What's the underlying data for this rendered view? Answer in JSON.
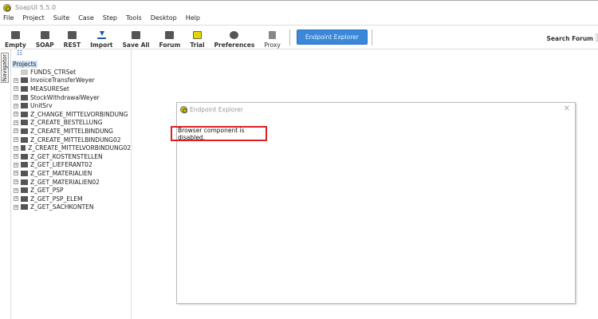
{
  "window": {
    "title": "SoapUI 5.5.0"
  },
  "menu": [
    "File",
    "Project",
    "Suite",
    "Case",
    "Step",
    "Tools",
    "Desktop",
    "Help"
  ],
  "toolbar": {
    "buttons": [
      {
        "label": "Empty",
        "icon": "empty-project-icon"
      },
      {
        "label": "SOAP",
        "icon": "soap-icon"
      },
      {
        "label": "REST",
        "icon": "rest-icon"
      },
      {
        "label": "Import",
        "icon": "import-icon"
      },
      {
        "label": "Save All",
        "icon": "save-all-icon"
      },
      {
        "label": "Forum",
        "icon": "forum-icon"
      },
      {
        "label": "Trial",
        "icon": "trial-icon"
      },
      {
        "label": "Preferences",
        "icon": "gear-icon"
      },
      {
        "label": "Proxy",
        "icon": "proxy-icon"
      }
    ],
    "endpoint_explorer": "Endpoint Explorer",
    "search_label": "Search Forum"
  },
  "navigator": {
    "tab": "Navigator",
    "root": "Projects",
    "items": [
      {
        "label": "FUNDS_CTRSet",
        "expandable": false
      },
      {
        "label": "InvoiceTransferWeyer",
        "expandable": true
      },
      {
        "label": "MEASURESet",
        "expandable": true
      },
      {
        "label": "StockWithdrawalWeyer",
        "expandable": true
      },
      {
        "label": "UnitSrv",
        "expandable": true
      },
      {
        "label": "Z_CHANGE_MITTELVORBINDUNG",
        "expandable": true
      },
      {
        "label": "Z_CREATE_BESTELLUNG",
        "expandable": true
      },
      {
        "label": "Z_CREATE_MITTELBINDUNG",
        "expandable": true
      },
      {
        "label": "Z_CREATE_MITTELBINDUNG02",
        "expandable": true
      },
      {
        "label": "Z_CREATE_MITTELVORBINDUNG02",
        "expandable": true
      },
      {
        "label": "Z_GET_KOSTENSTELLEN",
        "expandable": true
      },
      {
        "label": "Z_GET_LIEFERANT02",
        "expandable": true
      },
      {
        "label": "Z_GET_MATERIALIEN",
        "expandable": true
      },
      {
        "label": "Z_GET_MATERIALIEN02",
        "expandable": true
      },
      {
        "label": "Z_GET_PSP",
        "expandable": true
      },
      {
        "label": "Z_GET_PSP_ELEM",
        "expandable": true
      },
      {
        "label": "Z_GET_SACHKONTEN",
        "expandable": true
      }
    ]
  },
  "dialog": {
    "title": "Endpoint Explorer",
    "message": "Browser component is disabled.",
    "close": "✕"
  }
}
